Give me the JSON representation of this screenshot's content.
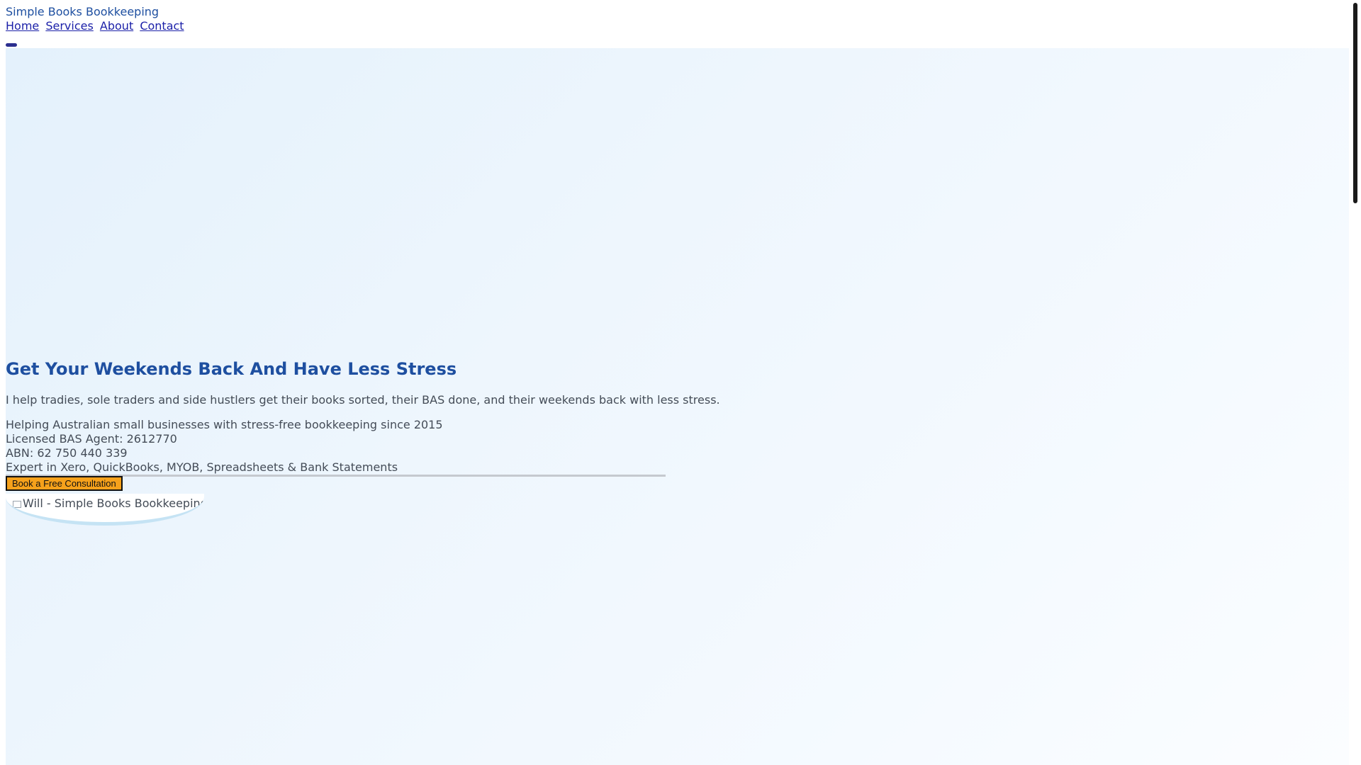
{
  "header": {
    "brand": "Simple Books Bookkeeping",
    "nav": [
      "Home",
      "Services",
      "About",
      "Contact"
    ]
  },
  "hero": {
    "title": "Get Your Weekends Back And Have Less Stress",
    "description": "I help tradies, sole traders and side hustlers get their books sorted, their BAS done, and their weekends back with less stress.",
    "facts": [
      "Helping Australian small businesses with stress-free bookkeeping since 2015",
      "Licensed BAS Agent: 2612770",
      "ABN: 62 750 440 339",
      "Expert in Xero, QuickBooks, MYOB, Spreadsheets & Bank Statements"
    ],
    "cta_label": "Book a Free Consultation",
    "photo_alt": "Will - Simple Books Bookkeeping"
  },
  "colors": {
    "brand_blue": "#1e4fa0",
    "link": "#1a1fa8",
    "cta": "#f6a11b",
    "hero_bg": "#e8f3fc"
  }
}
